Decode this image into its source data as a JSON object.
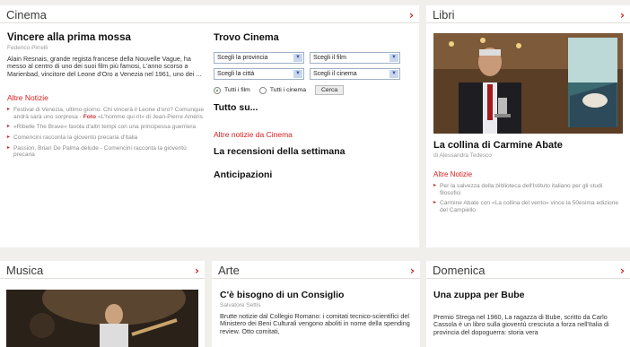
{
  "cinema": {
    "title": "Cinema",
    "arrow": "›",
    "article": {
      "headline": "Vincere alla prima mossa",
      "author": "Federico Pirrelli",
      "summary": "Alain Resnais, grande regista francese della Nouvelle Vague, ha messo al centro di uno dei suoi film più famosi, L'anno scorso a Marienbad, vincitore del Leone d'Oro a Venezia nel 1961, uno dei ..."
    },
    "altre_notizie": "Altre Notizie",
    "news": [
      {
        "text": "Festival di Venezia, ultimo giorno. Chi vincerà il Leone d'oro? Comunque andrà sarà uno sorpresa - ",
        "foto": "Foto",
        "after": " «L'homme qui rit» di Jean-Pierre Améris"
      },
      {
        "text": "«Ribelle The Brave» favola d'altri tempi con una principessa guerriera",
        "foto": "",
        "after": ""
      },
      {
        "text": "Comencini racconta la gioventù precaria d'Italia",
        "foto": "",
        "after": ""
      },
      {
        "text": "Passion, Brian De Palma delude - Comencini racconta la gioventù precaria",
        "foto": "",
        "after": ""
      }
    ],
    "trovo": {
      "title": "Trovo Cinema",
      "selects": [
        "Scegli la provincia",
        "Scegli il film",
        "Scegli la città",
        "Scegli il cinema"
      ],
      "radio_all_films": "Tutti i film",
      "radio_all_cinemas": "Tutti i cinema",
      "search_button": "Cerca",
      "tutto_su": "Tutto su...",
      "altre_notizie_cinema": "Altre notizie da Cinema",
      "recensioni": "La recensioni della settimana",
      "anticipazioni": "Anticipazioni"
    }
  },
  "libri": {
    "title": "Libri",
    "arrow": "›",
    "headline": "La collina di Carmine Abate",
    "author": "di Alessandra Tedesco",
    "altre_notizie": "Altre Notizie",
    "news": [
      "Per la salvezza della biblioteca dell'Istituto italiano per gli studi filosofici",
      "Carmine Abate con «La collina del vento» vince la 50esima edizione del Campiello"
    ]
  },
  "musica": {
    "title": "Musica",
    "arrow": "›"
  },
  "arte": {
    "title": "Arte",
    "arrow": "›",
    "headline": "C'è bisogno di un Consiglio",
    "author": "Salvatore Settis",
    "summary": "Brutte notizie dal Collegio Romano: i comitati tecnico-scientifici del Ministero dei Beni Culturali vengono aboliti in nome della spending review. Otto comitati,"
  },
  "domenica": {
    "title": "Domenica",
    "arrow": "›",
    "headline": "Una zuppa per Bube",
    "summary": "Premio Strega nel 1960, La ragazza di Bube, scritto da Carlo Cassola è un libro sulla gioventù cresciuta a forza nell'Italia di provincia del dopoguerra: storia vera"
  }
}
